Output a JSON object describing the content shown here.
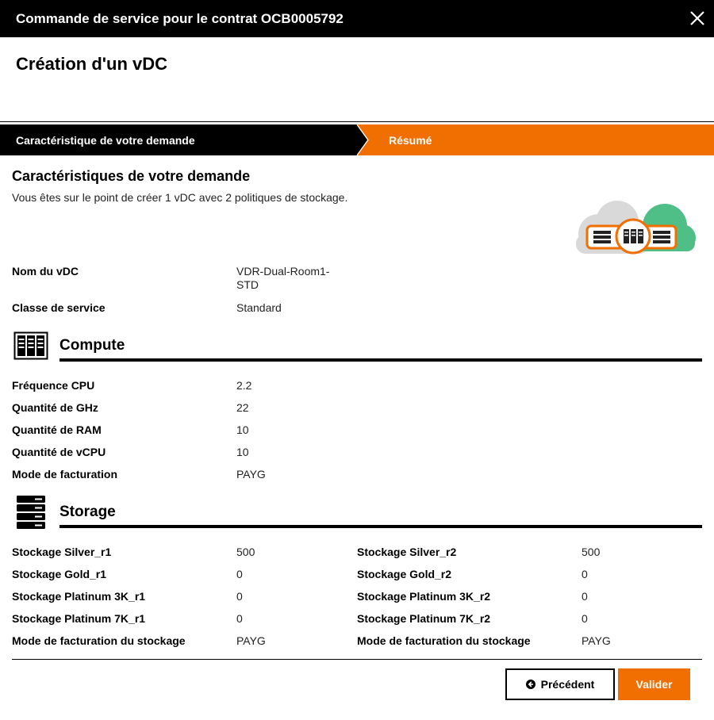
{
  "window": {
    "title": "Commande de service pour le contrat OCB0005792"
  },
  "page": {
    "title": "Création d'un vDC"
  },
  "stepper": {
    "steps": [
      {
        "label": "Caractéristique de votre demande",
        "state": "done"
      },
      {
        "label": "Résumé",
        "state": "active"
      }
    ]
  },
  "summary": {
    "heading": "Caractéristiques de votre demande",
    "description": "Vous êtes sur le point de créer 1 vDC avec 2 politiques de stockage.",
    "fields": [
      {
        "label": "Nom du vDC",
        "value_line1": "VDR-Dual-Room1-",
        "value_line2": "STD"
      },
      {
        "label": "Classe de service",
        "value": "Standard"
      }
    ]
  },
  "compute": {
    "title": "Compute",
    "icon": "server-rack-icon",
    "fields": [
      {
        "label": "Fréquence CPU",
        "value": "2.2"
      },
      {
        "label": "Quantité de GHz",
        "value": "22"
      },
      {
        "label": "Quantité de RAM",
        "value": "10"
      },
      {
        "label": "Quantité de vCPU",
        "value": "10"
      },
      {
        "label": "Mode de facturation",
        "value": "PAYG"
      }
    ]
  },
  "storage": {
    "title": "Storage",
    "icon": "storage-stack-icon",
    "left": [
      {
        "label": "Stockage Silver_r1",
        "value": "500"
      },
      {
        "label": "Stockage Gold_r1",
        "value": "0"
      },
      {
        "label": "Stockage Platinum 3K_r1",
        "value": "0"
      },
      {
        "label": "Stockage Platinum 7K_r1",
        "value": "0"
      },
      {
        "label": "Mode de facturation du stockage",
        "value": "PAYG"
      }
    ],
    "right": [
      {
        "label": "Stockage Silver_r2",
        "value": "500"
      },
      {
        "label": "Stockage Gold_r2",
        "value": "0"
      },
      {
        "label": "Stockage Platinum 3K_r2",
        "value": "0"
      },
      {
        "label": "Stockage Platinum 7K_r2",
        "value": "0"
      },
      {
        "label": "Mode de facturation du stockage",
        "value": "PAYG"
      }
    ]
  },
  "buttons": {
    "previous": "Précédent",
    "validate": "Valider"
  },
  "colors": {
    "accent": "#f16e00",
    "dark": "#000000",
    "cloud_gray": "#d9d9d9",
    "cloud_green": "#50be87"
  }
}
